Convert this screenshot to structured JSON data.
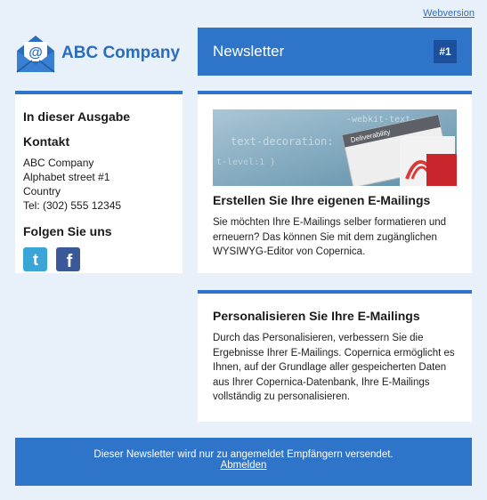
{
  "header": {
    "webversion": "Webversion",
    "company": "ABC Company",
    "title": "Newsletter",
    "issue": "#1"
  },
  "sidebar": {
    "issue_heading": "In dieser Ausgabe",
    "contact_heading": "Kontakt",
    "contact_lines": [
      "ABC Company",
      "Alphabet street #1",
      "Country",
      "Tel: (302) 555 12345"
    ],
    "follow_heading": "Folgen Sie uns",
    "social": [
      {
        "name": "twitter-icon",
        "color": "#3aa6d8",
        "glyph": "t"
      },
      {
        "name": "facebook-icon",
        "color": "#3b5998",
        "glyph": "f"
      }
    ]
  },
  "articles": [
    {
      "title": "Erstellen Sie Ihre eigenen E-Mailings",
      "body": "Sie möchten Ihre E-Mailings selber formatieren und erneuern? Das können Sie mit dem zugänglichen WYSIWYG-Editor von Copernica."
    },
    {
      "title": "Personalisieren Sie Ihre E-Mailings",
      "body": "Durch das Personalisieren, verbessern Sie die Ergebnisse Ihrer E-Mailings. Copernica ermöglicht es Ihnen, auf der Grundlage aller gespeicherten Daten aus Ihrer Copernica-Datenbank, Ihre E-Mailings vollständig zu personalisieren."
    }
  ],
  "hero_image": {
    "texts": [
      "-webkit-text-",
      "text-decoration:",
      "Deliverability"
    ]
  },
  "footer": {
    "note": "Dieser Newsletter wird nur zu angemeldet Empfängern versendet.",
    "unsubscribe": "Abmelden"
  },
  "colors": {
    "accent": "#2e74c8",
    "background": "#e8f0fa",
    "badge": "#1c4f9c"
  }
}
